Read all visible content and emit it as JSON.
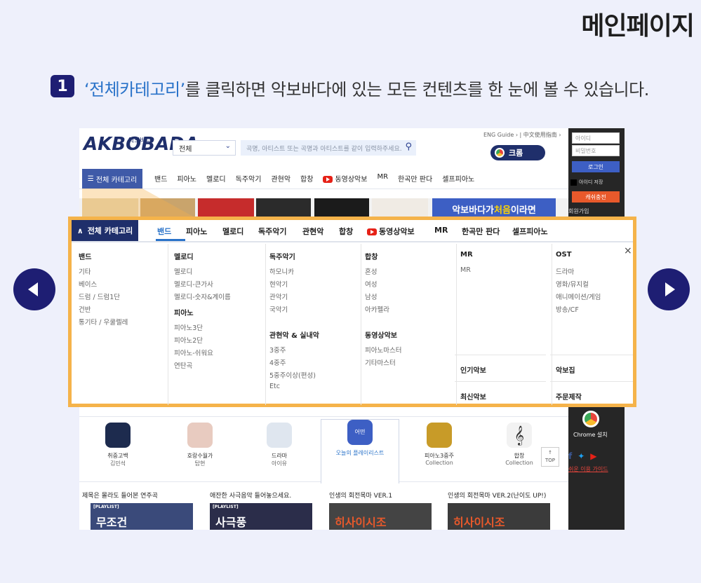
{
  "slide_title": "메인페이지",
  "step": {
    "number": "1",
    "highlight": "‘전체카테고리’",
    "text": "를 클릭하면 악보바다에 있는 모든 컨텐츠를 한 눈에 볼 수 있습니다."
  },
  "site": {
    "logo": "AKBOBADA",
    "logo_small": "악보바다",
    "select_value": "전체",
    "search_placeholder": "곡명, 아티스트 또는 곡명과 아티스트를 같이 입력하주세요.",
    "top_links": "ENG Guide ›  |  中文使用指南 ›",
    "chrome_button": "크롬",
    "all_category": "전체 카테고리",
    "main_nav": [
      "밴드",
      "피아노",
      "멜로디",
      "독주악기",
      "관현악",
      "합창",
      "동영상악보",
      "MR",
      "한곡만 판다",
      "셀프피아노"
    ],
    "promo_text_a": "악보바다가 ",
    "promo_text_b": "처음",
    "promo_text_c": "이라면"
  },
  "sidebar": {
    "id_placeholder": "아이디",
    "pw_placeholder": "비밀번호",
    "login": "로그인",
    "keep_id": "아이디 저장",
    "cash": "캐쉬충전",
    "join": "회원가입",
    "chrome_install": "Chrome 설치",
    "guide": "쉬운 이용 가이드"
  },
  "dropdown": {
    "all_category": "전체 카테고리",
    "tabs": [
      "밴드",
      "피아노",
      "멜로디",
      "독주악기",
      "관현악",
      "합창",
      "동영상악보",
      "MR",
      "한곡만 판다",
      "셀프피아노"
    ],
    "close": "×",
    "columns": {
      "band": {
        "head": "밴드",
        "items": [
          "기타",
          "베이스",
          "드럼 / 드럼1단",
          "건반",
          "통기타 / 우쿨렐레"
        ]
      },
      "melody": {
        "head": "멜로디",
        "items": [
          "멜로디",
          "멜로디-큰가사",
          "멜로디-숫자&계이름"
        ]
      },
      "piano": {
        "head": "피아노",
        "items": [
          "피아노3단",
          "피아노2단",
          "피아노-쉬워요",
          "연탄곡"
        ]
      },
      "solo": {
        "head": "독주악기",
        "items": [
          "하모니카",
          "현악기",
          "관악기",
          "국악기"
        ]
      },
      "orchestra": {
        "head": "관현악 & 실내악",
        "items": [
          "3중주",
          "4중주",
          "5중주이상(편성)",
          "Etc"
        ]
      },
      "chorus": {
        "head": "합창",
        "items": [
          "혼성",
          "여성",
          "남성",
          "아카펠라"
        ]
      },
      "video": {
        "head": "동영상악보",
        "items": [
          "피아노마스터",
          "기타마스터"
        ]
      },
      "mr": {
        "head": "MR",
        "items": [
          "MR"
        ]
      },
      "popular": "인기악보",
      "latest": "최신악보",
      "ost": {
        "head": "OST",
        "items": [
          "드라마",
          "영화/뮤지컬",
          "애니메이션/게임",
          "방송/CF"
        ]
      },
      "collection": "악보집",
      "custom": "주문제작"
    }
  },
  "playlist_tabs": [
    {
      "t1": "취중고백",
      "t2": "김민석"
    },
    {
      "t1": "호랑수월가",
      "t2": "탑현"
    },
    {
      "t1": "드라마",
      "t2": "아이유"
    },
    {
      "t1": "오늘의 플레이리스트",
      "t2": "",
      "thumb_text": "어떤"
    },
    {
      "t1": "피아노3중주",
      "t2": "Collection"
    },
    {
      "t1": "합창",
      "t2": "Collection"
    }
  ],
  "top_button": "TOP",
  "playlists": [
    {
      "title": "제목은 몰라도 들어본 연주곡",
      "tag": "[PLAYLIST]",
      "big": "무조건"
    },
    {
      "title": "애잔한 사극음악 들어놓으세요.",
      "tag": "[PLAYLIST]",
      "big": "사극풍"
    },
    {
      "title": "인생의 회전목마 VER.1",
      "tag": "",
      "big": "히사이시조"
    },
    {
      "title": "인생의 회전목마 VER.2(난이도 UP!)",
      "tag": "",
      "big": "히사이시조"
    }
  ]
}
